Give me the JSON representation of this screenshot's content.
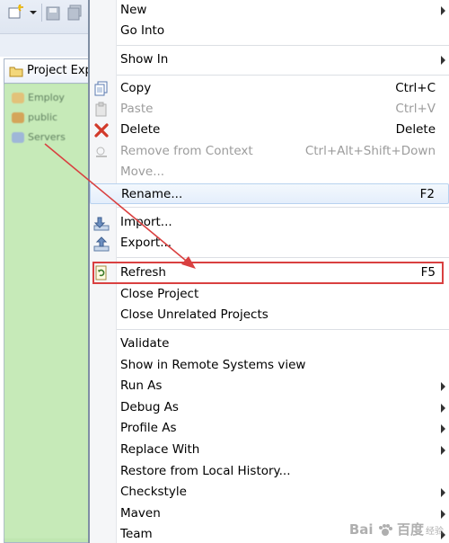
{
  "project_explorer": {
    "tab_label": "Project Exp",
    "tree_rows": [
      "Employ",
      "public",
      "Servers"
    ]
  },
  "context_menu": {
    "items": [
      {
        "id": "new",
        "label": "New",
        "shortcut": "",
        "submenu": true,
        "enabled": true,
        "icon": ""
      },
      {
        "id": "go-into",
        "label": "Go Into",
        "shortcut": "",
        "submenu": false,
        "enabled": true,
        "icon": ""
      },
      {
        "id": "show-in",
        "label": "Show In",
        "shortcut": "",
        "submenu": true,
        "enabled": true,
        "icon": ""
      },
      {
        "id": "copy",
        "label": "Copy",
        "shortcut": "Ctrl+C",
        "submenu": false,
        "enabled": true,
        "icon": "copy-icon"
      },
      {
        "id": "paste",
        "label": "Paste",
        "shortcut": "Ctrl+V",
        "submenu": false,
        "enabled": false,
        "icon": "paste-icon"
      },
      {
        "id": "delete",
        "label": "Delete",
        "shortcut": "Delete",
        "submenu": false,
        "enabled": true,
        "icon": "delete-x-icon"
      },
      {
        "id": "remove-from-context",
        "label": "Remove from Context",
        "shortcut": "Ctrl+Alt+Shift+Down",
        "submenu": false,
        "enabled": false,
        "icon": "remove-context-icon"
      },
      {
        "id": "move",
        "label": "Move...",
        "shortcut": "",
        "submenu": false,
        "enabled": false,
        "icon": ""
      },
      {
        "id": "rename",
        "label": "Rename...",
        "shortcut": "F2",
        "submenu": false,
        "enabled": true,
        "icon": ""
      },
      {
        "id": "import",
        "label": "Import...",
        "shortcut": "",
        "submenu": false,
        "enabled": true,
        "icon": "import-icon"
      },
      {
        "id": "export",
        "label": "Export...",
        "shortcut": "",
        "submenu": false,
        "enabled": true,
        "icon": "export-icon"
      },
      {
        "id": "refresh",
        "label": "Refresh",
        "shortcut": "F5",
        "submenu": false,
        "enabled": true,
        "icon": "refresh-icon"
      },
      {
        "id": "close-project",
        "label": "Close Project",
        "shortcut": "",
        "submenu": false,
        "enabled": true,
        "icon": ""
      },
      {
        "id": "close-unrelated",
        "label": "Close Unrelated Projects",
        "shortcut": "",
        "submenu": false,
        "enabled": true,
        "icon": ""
      },
      {
        "id": "validate",
        "label": "Validate",
        "shortcut": "",
        "submenu": false,
        "enabled": true,
        "icon": ""
      },
      {
        "id": "show-remote",
        "label": "Show in Remote Systems view",
        "shortcut": "",
        "submenu": false,
        "enabled": true,
        "icon": ""
      },
      {
        "id": "run-as",
        "label": "Run As",
        "shortcut": "",
        "submenu": true,
        "enabled": true,
        "icon": ""
      },
      {
        "id": "debug-as",
        "label": "Debug As",
        "shortcut": "",
        "submenu": true,
        "enabled": true,
        "icon": ""
      },
      {
        "id": "profile-as",
        "label": "Profile As",
        "shortcut": "",
        "submenu": true,
        "enabled": true,
        "icon": ""
      },
      {
        "id": "replace-with",
        "label": "Replace With",
        "shortcut": "",
        "submenu": true,
        "enabled": true,
        "icon": ""
      },
      {
        "id": "restore-history",
        "label": "Restore from Local History...",
        "shortcut": "",
        "submenu": false,
        "enabled": true,
        "icon": ""
      },
      {
        "id": "checkstyle",
        "label": "Checkstyle",
        "shortcut": "",
        "submenu": true,
        "enabled": true,
        "icon": ""
      },
      {
        "id": "maven",
        "label": "Maven",
        "shortcut": "",
        "submenu": true,
        "enabled": true,
        "icon": ""
      },
      {
        "id": "team",
        "label": "Team",
        "shortcut": "",
        "submenu": true,
        "enabled": true,
        "icon": ""
      }
    ]
  },
  "highlight": {
    "target": "refresh",
    "color": "#d94040"
  },
  "watermark": {
    "brand": "Bai",
    "brand2": "百度",
    "sub": "经验",
    "url": "jingyan.baidu.com"
  },
  "colors": {
    "tree_bg": "#c6eab8",
    "menu_gutter": "#f5f6f8",
    "disabled_text": "#9c9c9c"
  }
}
